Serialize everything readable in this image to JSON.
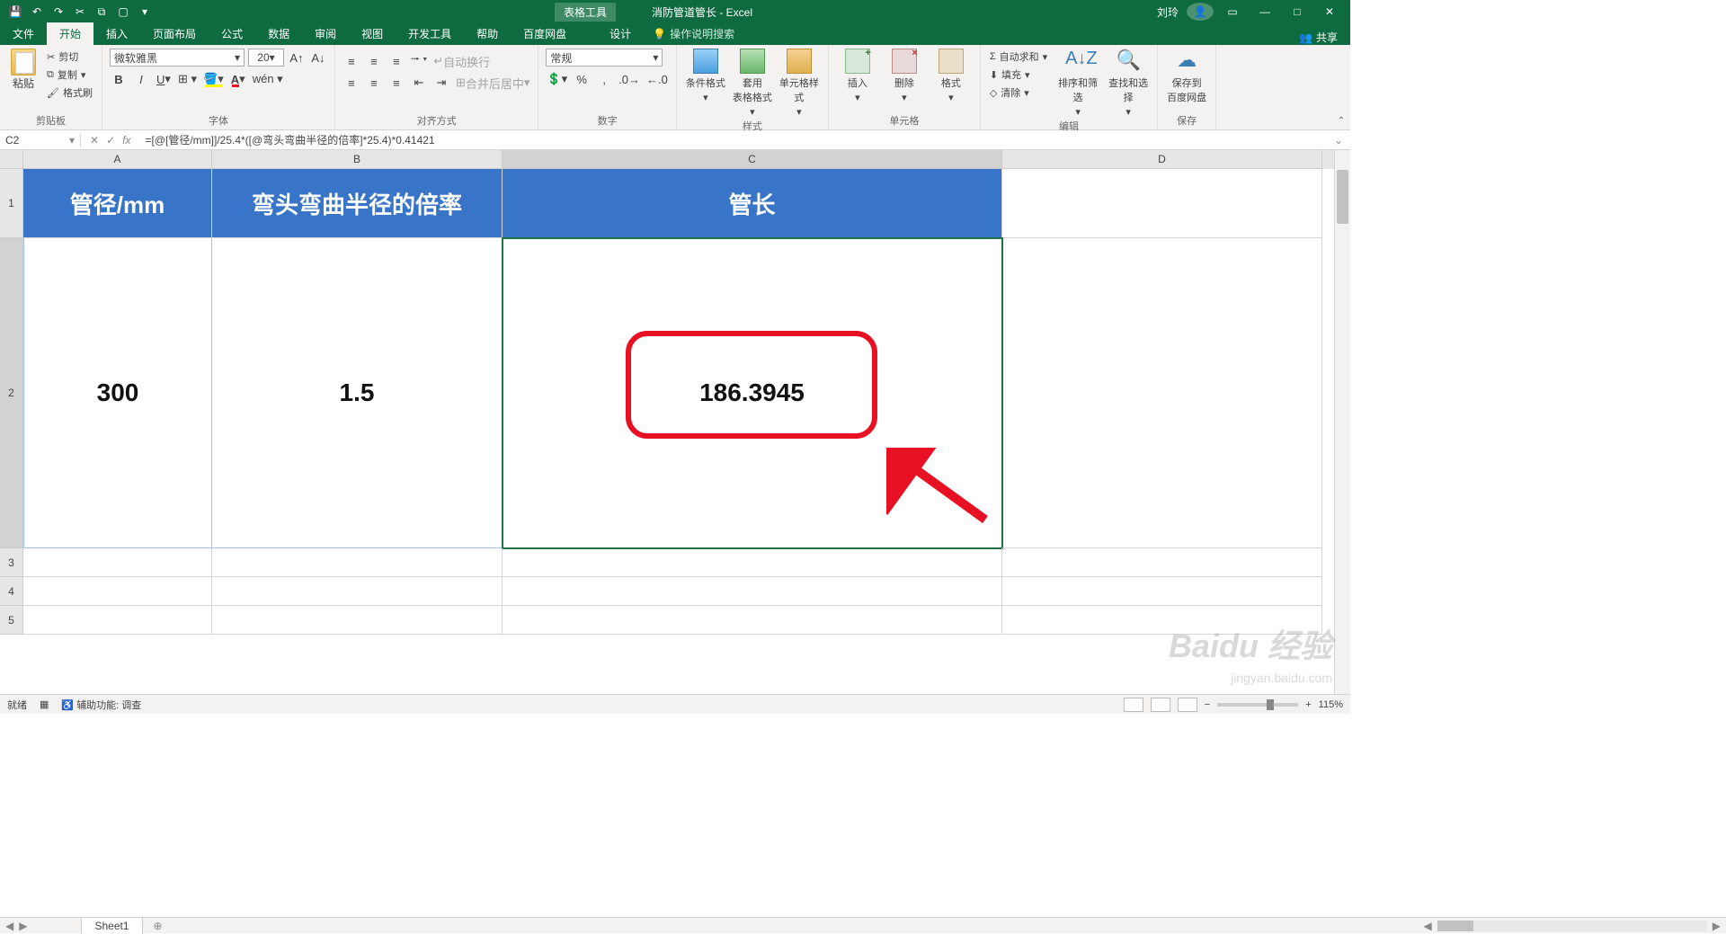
{
  "title": {
    "context": "表格工具",
    "doc": "消防管道管长 - Excel",
    "user": "刘玲"
  },
  "qat": [
    "save",
    "undo",
    "redo",
    "cut",
    "copy",
    "new",
    "down"
  ],
  "tabs": {
    "items": [
      "文件",
      "开始",
      "插入",
      "页面布局",
      "公式",
      "数据",
      "审阅",
      "视图",
      "开发工具",
      "帮助",
      "百度网盘",
      "设计"
    ],
    "active": 1,
    "tellme": "操作说明搜索",
    "share": "共享"
  },
  "ribbon": {
    "clipboard": {
      "paste": "粘贴",
      "cut": "剪切",
      "copy": "复制",
      "format": "格式刷",
      "label": "剪贴板"
    },
    "font": {
      "name": "微软雅黑",
      "size": "20",
      "label": "字体"
    },
    "align": {
      "wrap": "自动换行",
      "merge": "合并后居中",
      "label": "对齐方式"
    },
    "number": {
      "format": "常规",
      "label": "数字"
    },
    "styles": {
      "cond": "条件格式",
      "table": "套用\n表格格式",
      "cell": "单元格样式",
      "label": "样式"
    },
    "cells": {
      "insert": "插入",
      "delete": "删除",
      "format": "格式",
      "label": "单元格"
    },
    "editing": {
      "sum": "自动求和",
      "fill": "填充",
      "clear": "清除",
      "sort": "排序和筛选",
      "find": "查找和选择",
      "label": "编辑"
    },
    "save": {
      "btn": "保存到\n百度网盘",
      "label": "保存"
    }
  },
  "namebox": "C2",
  "formula": "=[@[管径/mm]]/25.4*([@弯头弯曲半径的倍率]*25.4)*0.41421",
  "cols": {
    "A": 210,
    "B": 323,
    "C": 556,
    "D": 356
  },
  "rows": {
    "1": 77,
    "2": 345,
    "3": 32,
    "4": 32,
    "5": 32
  },
  "headers": {
    "A": "管径/mm",
    "B": "弯头弯曲半径的倍率",
    "C": "管长"
  },
  "data": {
    "A2": "300",
    "B2": "1.5",
    "C2": "186.3945"
  },
  "sheet": "Sheet1",
  "status": {
    "ready": "就绪",
    "acc": "辅助功能: 调查",
    "zoom": "115%"
  },
  "watermark": {
    "main": "Baidu 经验",
    "sub": "jingyan.baidu.com"
  }
}
